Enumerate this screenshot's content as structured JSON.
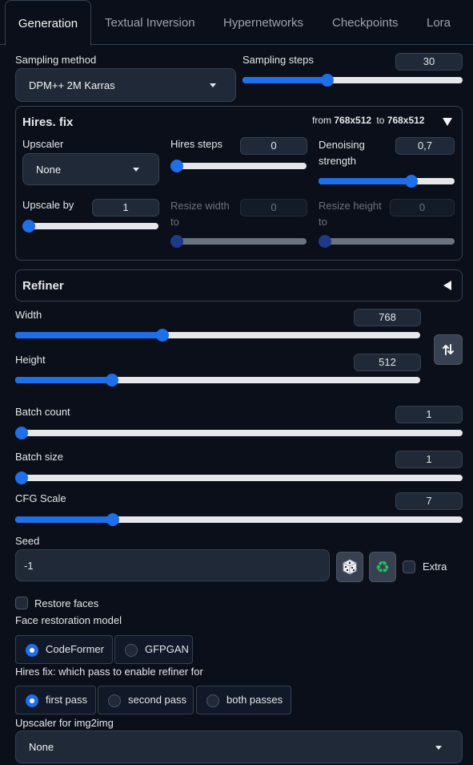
{
  "tabs": [
    {
      "label": "Generation",
      "active": true
    },
    {
      "label": "Textual Inversion",
      "active": false
    },
    {
      "label": "Hypernetworks",
      "active": false
    },
    {
      "label": "Checkpoints",
      "active": false
    },
    {
      "label": "Lora",
      "active": false
    }
  ],
  "sampling": {
    "method_label": "Sampling method",
    "method_value": "DPM++ 2M Karras",
    "steps_label": "Sampling steps",
    "steps_value": "30",
    "steps_level": 0.38
  },
  "hires": {
    "title": "Hires. fix",
    "from_prefix": "from",
    "from_size": "768x512",
    "to_prefix": "to",
    "to_size": "768x512",
    "upscaler_label": "Upscaler",
    "upscaler_value": "None",
    "steps_label": "Hires steps",
    "steps_value": "0",
    "steps_level": 0.0,
    "denoise_label": "Denoising strength",
    "denoise_value": "0,7",
    "denoise_level": 0.7,
    "upscale_by_label": "Upscale by",
    "upscale_by_value": "1",
    "upscale_by_level": 0.0,
    "resize_w_label": "Resize width to",
    "resize_w_value": "0",
    "resize_h_label": "Resize height to",
    "resize_h_value": "0"
  },
  "refiner": {
    "title": "Refiner"
  },
  "size": {
    "width_label": "Width",
    "width_value": "768",
    "width_level": 0.36,
    "height_label": "Height",
    "height_value": "512",
    "height_level": 0.23,
    "swap_icon": "swap-arrows-icon"
  },
  "batch": {
    "count_label": "Batch count",
    "count_value": "1",
    "count_level": 0.0,
    "size_label": "Batch size",
    "size_value": "1",
    "size_level": 0.0
  },
  "cfg": {
    "label": "CFG Scale",
    "value": "7",
    "level": 0.21
  },
  "seed": {
    "label": "Seed",
    "value": "-1",
    "random_icon": "dice-icon",
    "reuse_icon": "recycle-icon",
    "extra_label": "Extra"
  },
  "restore_faces": {
    "label": "Restore faces",
    "model_label": "Face restoration model",
    "options": [
      "CodeFormer",
      "GFPGAN"
    ],
    "selected": "CodeFormer"
  },
  "refiner_pass": {
    "label": "Hires fix: which pass to enable refiner for",
    "options": [
      "first pass",
      "second pass",
      "both passes"
    ],
    "selected": "first pass"
  },
  "img2img_upscaler": {
    "label": "Upscaler for img2img",
    "value": "None"
  },
  "colors": {
    "accent": "#1f6feb",
    "background": "#0b0f19",
    "panel_border": "#374151",
    "input_bg": "#1f2937"
  }
}
